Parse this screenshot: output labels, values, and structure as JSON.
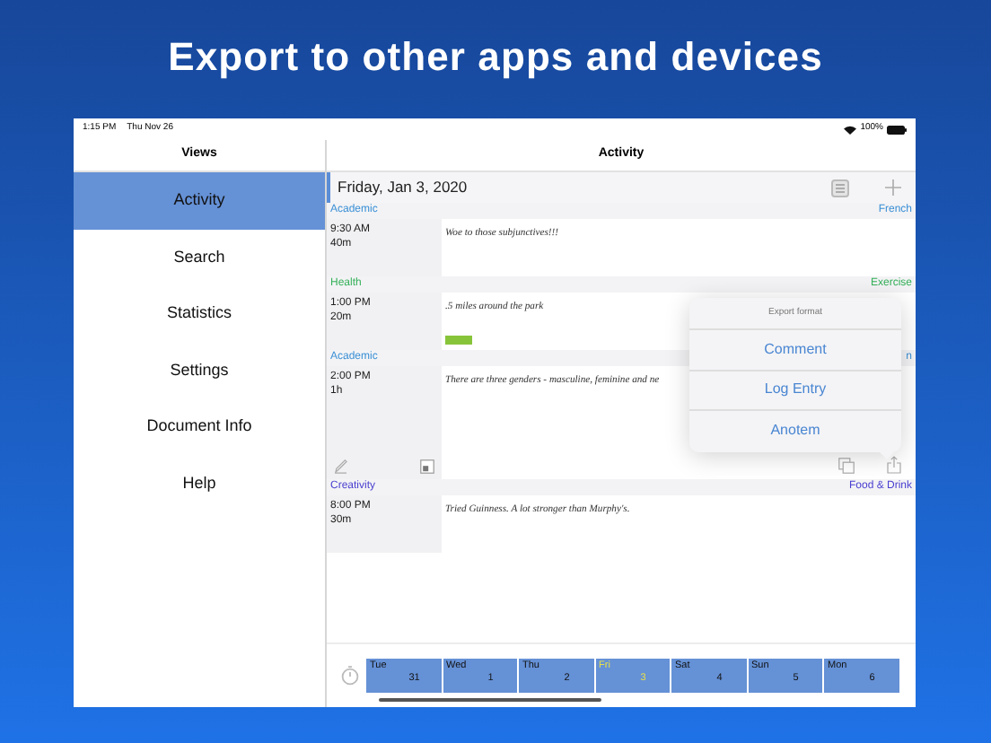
{
  "headline": "Export to other apps and devices",
  "status_bar": {
    "time": "1:15 PM",
    "date": "Thu Nov 26",
    "battery": "100%"
  },
  "sidebar": {
    "title": "Views",
    "items": [
      {
        "label": "Activity",
        "selected": true
      },
      {
        "label": "Search",
        "selected": false
      },
      {
        "label": "Statistics",
        "selected": false
      },
      {
        "label": "Settings",
        "selected": false
      },
      {
        "label": "Document Info",
        "selected": false
      },
      {
        "label": "Help",
        "selected": false
      }
    ]
  },
  "main": {
    "title": "Activity",
    "date": "Friday, Jan 3, 2020",
    "entries": [
      {
        "category": "Academic",
        "topic": "French",
        "color": "#3a8fd6",
        "time": "9:30 AM",
        "duration": "40m",
        "note": "Woe to those subjunctives!!!",
        "marker": false,
        "tools": false
      },
      {
        "category": "Health",
        "topic": "Exercise",
        "color": "#34b058",
        "time": "1:00 PM",
        "duration": "20m",
        "note": ".5 miles around the park",
        "marker": true,
        "tools": false
      },
      {
        "category": "Academic",
        "topic": "n",
        "color": "#3a8fd6",
        "time": "2:00 PM",
        "duration": "1h",
        "note": "There are three genders - masculine, feminine and ne",
        "marker": false,
        "tools": true
      },
      {
        "category": "Creativity",
        "topic": "Food & Drink",
        "color": "#4a3fd0",
        "time": "8:00 PM",
        "duration": "30m",
        "note": "Tried Guinness. A lot stronger than Murphy's.",
        "marker": false,
        "tools": false
      }
    ]
  },
  "popover": {
    "title": "Export format",
    "options": [
      "Comment",
      "Log Entry",
      "Anotem"
    ]
  },
  "day_strip": [
    {
      "day": "Tue",
      "number": "31",
      "selected": false
    },
    {
      "day": "Wed",
      "number": "1",
      "selected": false
    },
    {
      "day": "Thu",
      "number": "2",
      "selected": false
    },
    {
      "day": "Fri",
      "number": "3",
      "selected": true
    },
    {
      "day": "Sat",
      "number": "4",
      "selected": false
    },
    {
      "day": "Sun",
      "number": "5",
      "selected": false
    },
    {
      "day": "Mon",
      "number": "6",
      "selected": false
    }
  ]
}
